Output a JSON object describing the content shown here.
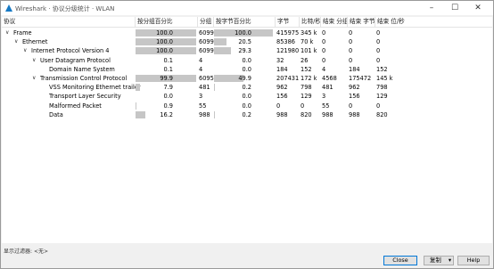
{
  "window": {
    "title": "Wireshark · 协议分级统计 · WLAN"
  },
  "columns": [
    "协议",
    "按分组百分比",
    "分组",
    "按字节百分比",
    "字节",
    "比特/秒",
    "结束 分组",
    "结束 字节",
    "结束 位/秒"
  ],
  "rows": [
    {
      "depth": 0,
      "expanded": true,
      "protocol": "Frame",
      "pkt_pct": "100.0",
      "pkt_pct_val": 100.0,
      "packets": "6099",
      "byte_pct": "100.0",
      "byte_pct_val": 100.0,
      "bytes": "415975",
      "bps": "345 k",
      "end_packets": "0",
      "end_bytes": "0",
      "end_bps": "0"
    },
    {
      "depth": 1,
      "expanded": true,
      "protocol": "Ethernet",
      "pkt_pct": "100.0",
      "pkt_pct_val": 100.0,
      "packets": "6099",
      "byte_pct": "20.5",
      "byte_pct_val": 20.5,
      "bytes": "85386",
      "bps": "70 k",
      "end_packets": "0",
      "end_bytes": "0",
      "end_bps": "0"
    },
    {
      "depth": 2,
      "expanded": true,
      "protocol": "Internet Protocol Version 4",
      "pkt_pct": "100.0",
      "pkt_pct_val": 100.0,
      "packets": "6099",
      "byte_pct": "29.3",
      "byte_pct_val": 29.3,
      "bytes": "121980",
      "bps": "101 k",
      "end_packets": "0",
      "end_bytes": "0",
      "end_bps": "0"
    },
    {
      "depth": 3,
      "expanded": true,
      "protocol": "User Datagram Protocol",
      "pkt_pct": "0.1",
      "pkt_pct_val": 0.1,
      "packets": "4",
      "byte_pct": "0.0",
      "byte_pct_val": 0.0,
      "bytes": "32",
      "bps": "26",
      "end_packets": "0",
      "end_bytes": "0",
      "end_bps": "0"
    },
    {
      "depth": 4,
      "expanded": null,
      "protocol": "Domain Name System",
      "pkt_pct": "0.1",
      "pkt_pct_val": 0.1,
      "packets": "4",
      "byte_pct": "0.0",
      "byte_pct_val": 0.0,
      "bytes": "184",
      "bps": "152",
      "end_packets": "4",
      "end_bytes": "184",
      "end_bps": "152"
    },
    {
      "depth": 3,
      "expanded": true,
      "protocol": "Transmission Control Protocol",
      "pkt_pct": "99.9",
      "pkt_pct_val": 99.9,
      "packets": "6095",
      "byte_pct": "49.9",
      "byte_pct_val": 49.9,
      "bytes": "207431",
      "bps": "172 k",
      "end_packets": "4568",
      "end_bytes": "175472",
      "end_bps": "145 k"
    },
    {
      "depth": 4,
      "expanded": null,
      "protocol": "VSS Monitoring Ethernet trailer",
      "pkt_pct": "7.9",
      "pkt_pct_val": 7.9,
      "packets": "481",
      "byte_pct": "0.2",
      "byte_pct_val": 0.2,
      "bytes": "962",
      "bps": "798",
      "end_packets": "481",
      "end_bytes": "962",
      "end_bps": "798"
    },
    {
      "depth": 4,
      "expanded": null,
      "protocol": "Transport Layer Security",
      "pkt_pct": "0.0",
      "pkt_pct_val": 0.0,
      "packets": "3",
      "byte_pct": "0.0",
      "byte_pct_val": 0.0,
      "bytes": "156",
      "bps": "129",
      "end_packets": "3",
      "end_bytes": "156",
      "end_bps": "129"
    },
    {
      "depth": 4,
      "expanded": null,
      "protocol": "Malformed Packet",
      "pkt_pct": "0.9",
      "pkt_pct_val": 0.9,
      "packets": "55",
      "byte_pct": "0.0",
      "byte_pct_val": 0.0,
      "bytes": "0",
      "bps": "0",
      "end_packets": "55",
      "end_bytes": "0",
      "end_bps": "0"
    },
    {
      "depth": 4,
      "expanded": null,
      "protocol": "Data",
      "pkt_pct": "16.2",
      "pkt_pct_val": 16.2,
      "packets": "988",
      "byte_pct": "0.2",
      "byte_pct_val": 0.2,
      "bytes": "988",
      "bps": "820",
      "end_packets": "988",
      "end_bytes": "988",
      "end_bps": "820"
    }
  ],
  "status": {
    "label": "显示过滤器:",
    "value": "<无>"
  },
  "buttons": {
    "close": "Close",
    "copy": "复制",
    "help": "Help"
  },
  "colors": {
    "bar": "#c6c6c6",
    "accent": "#0078d7",
    "icon": "#1679c4"
  }
}
